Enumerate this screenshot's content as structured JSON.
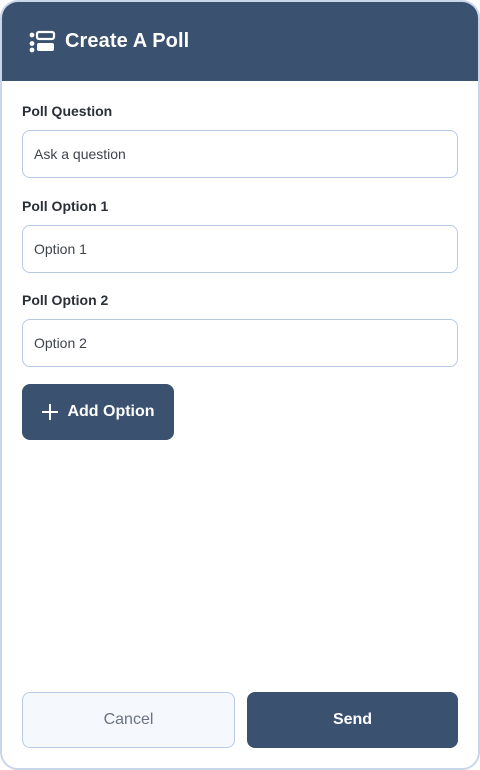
{
  "header": {
    "title": "Create A Poll",
    "icon": "poll-list-icon"
  },
  "fields": [
    {
      "label": "Poll Question",
      "placeholder": "Ask a question",
      "value": ""
    },
    {
      "label": "Poll Option 1",
      "placeholder": "Option 1",
      "value": ""
    },
    {
      "label": "Poll Option 2",
      "placeholder": "Option 2",
      "value": ""
    }
  ],
  "add_option": {
    "label": "Add Option",
    "icon": "plus-icon"
  },
  "footer": {
    "cancel_label": "Cancel",
    "send_label": "Send"
  },
  "colors": {
    "primary": "#3a5170",
    "border": "#b8c9e3",
    "cancel_bg": "#f5f9fe",
    "dialog_border": "#c9d6ea"
  }
}
